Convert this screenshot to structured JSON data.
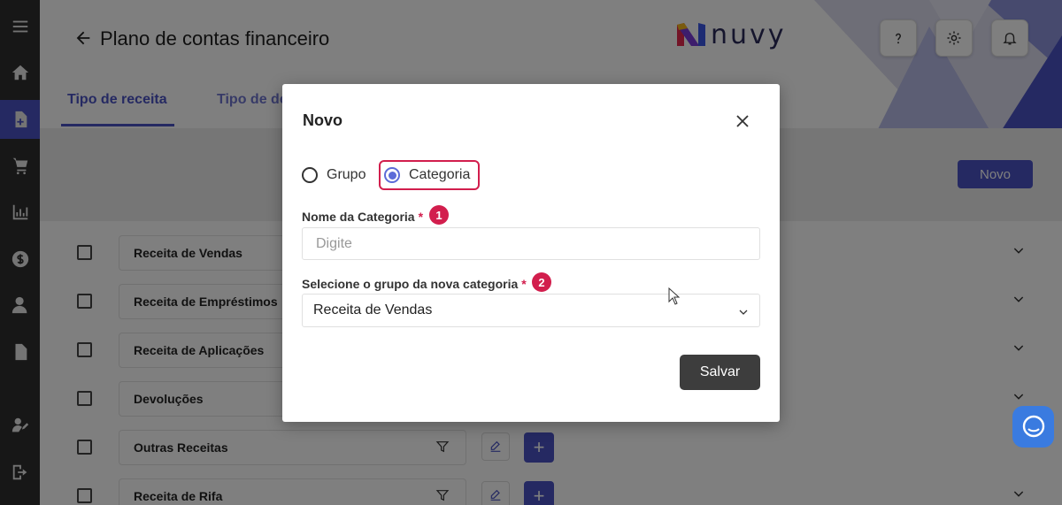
{
  "page": {
    "title": "Plano de contas financeiro",
    "logo_text": "nuvy",
    "tabs": [
      {
        "label": "Tipo de receita"
      },
      {
        "label": "Tipo de de"
      }
    ],
    "new_button_label": "Novo",
    "rows": [
      {
        "name": "Receita de Vendas"
      },
      {
        "name": "Receita de Empréstimos"
      },
      {
        "name": "Receita de Aplicações"
      },
      {
        "name": "Devoluções"
      },
      {
        "name": "Outras Receitas"
      },
      {
        "name": "Receita de Rifa"
      }
    ],
    "plus_label": "+"
  },
  "header_buttons": {
    "help_icon": "question-icon",
    "settings_icon": "gear-icon",
    "notifications_icon": "bell-icon"
  },
  "sidebar": {
    "items": [
      "menu-icon",
      "home-icon",
      "document-add-icon",
      "cart-icon",
      "chart-icon",
      "dollar-icon",
      "user-icon",
      "file-icon",
      "user-edit-icon",
      "logout-icon"
    ]
  },
  "modal": {
    "title": "Novo",
    "radio_options": [
      {
        "label": "Grupo",
        "checked": false
      },
      {
        "label": "Categoria",
        "checked": true
      }
    ],
    "name_field": {
      "label": "Nome da Categoria",
      "required_mark": "*",
      "step": "1",
      "placeholder": "Digite",
      "value": ""
    },
    "group_field": {
      "label": "Selecione o grupo da nova categoria",
      "required_mark": "*",
      "step": "2",
      "selected": "Receita de Vendas"
    },
    "save_label": "Salvar"
  },
  "colors": {
    "accent": "#4a53c4",
    "highlight": "#d21e4d",
    "sidebar": "#2f2f2f",
    "save_button": "#3d3d3d",
    "chat": "#3a7be0"
  }
}
